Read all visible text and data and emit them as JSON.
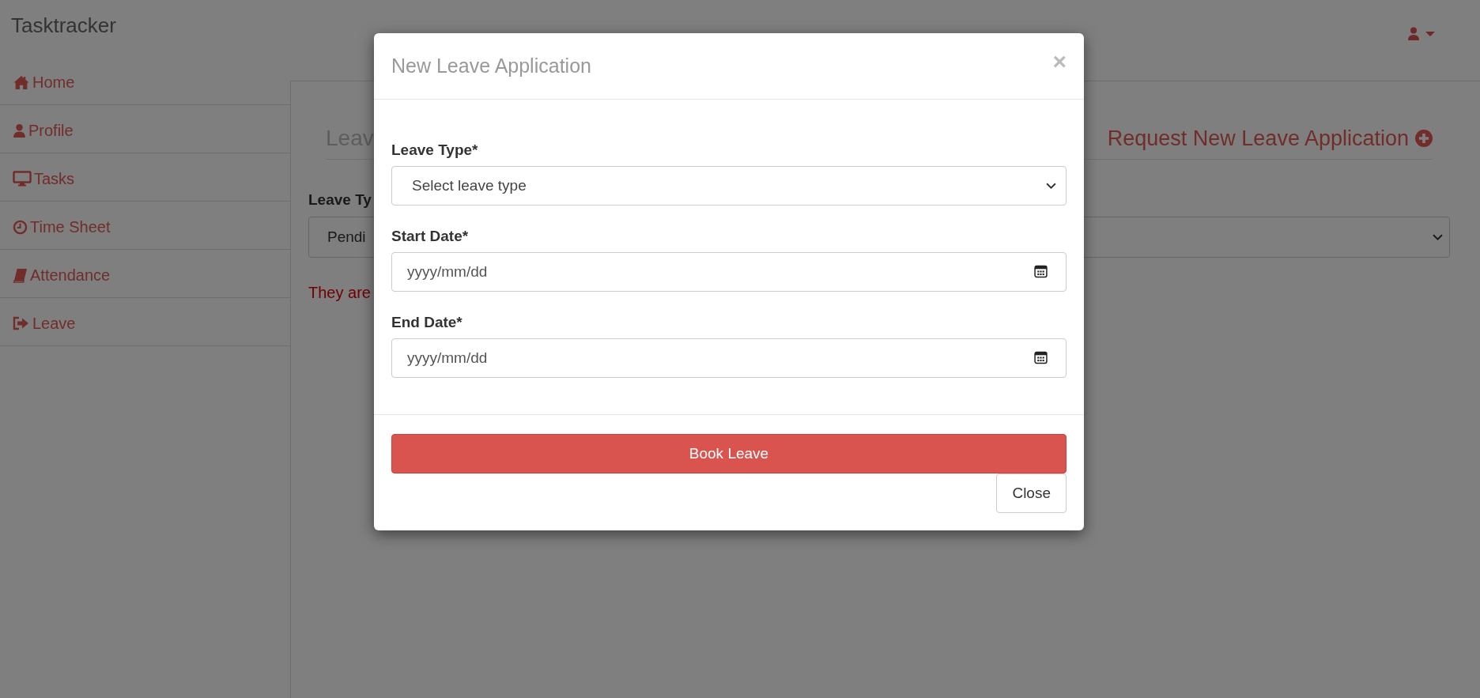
{
  "brand": "Tasktracker",
  "sidebar": {
    "items": [
      {
        "label": "Home"
      },
      {
        "label": "Profile"
      },
      {
        "label": "Tasks"
      },
      {
        "label": "Time Sheet"
      },
      {
        "label": "Attendance"
      },
      {
        "label": "Leave"
      }
    ]
  },
  "page": {
    "heading": "Leav",
    "action": "Request New Leave Application",
    "filter_label": "Leave Ty",
    "filter_value": "Pendi",
    "message": "They are"
  },
  "modal": {
    "title": "New Leave Application",
    "close": "×",
    "fields": [
      {
        "kind": "select",
        "label": "Leave Type*",
        "value": "Select leave type"
      },
      {
        "kind": "date",
        "label": "Start Date*",
        "placeholder": "yyyy/mm/dd"
      },
      {
        "kind": "date",
        "label": "End Date*",
        "placeholder": "yyyy/mm/dd"
      }
    ],
    "buttons": [
      {
        "kind": "primary",
        "label": "Book Leave"
      },
      {
        "kind": "default",
        "label": "Close"
      }
    ]
  }
}
